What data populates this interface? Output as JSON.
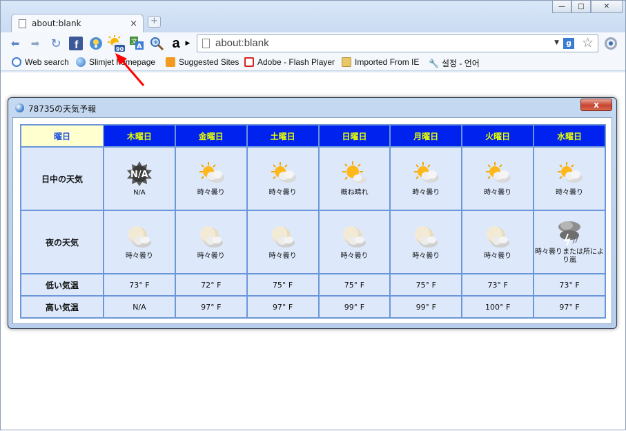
{
  "browser": {
    "tab_title": "about:blank",
    "tab_close": "×",
    "new_tab": "+",
    "url": "about:blank",
    "window_buttons": {
      "minimize": "—",
      "maximize": "□",
      "close": "✕"
    },
    "bookmarks": [
      {
        "label": "Web search",
        "icon": "search-icon",
        "color": "#3b7bd4"
      },
      {
        "label": "Slimjet homepage",
        "icon": "globe-icon",
        "color": "#2f74c8"
      },
      {
        "label": "Suggested Sites",
        "icon": "suggested-sites-icon",
        "color": "#f29b1f"
      },
      {
        "label": "Adobe - Flash Player",
        "icon": "adobe-icon",
        "color": "#d81f1f"
      },
      {
        "label": "Imported From IE",
        "icon": "folder-icon",
        "color": "#e8c769"
      },
      {
        "label": "설정 - 언어",
        "icon": "wrench-icon",
        "color": "#555555"
      }
    ],
    "weather_badge": "90"
  },
  "popup": {
    "title": "78735の天気予報",
    "close_label": "x",
    "corner_header": "曜日",
    "days": [
      "木曜日",
      "金曜日",
      "土曜日",
      "日曜日",
      "月曜日",
      "火曜日",
      "水曜日"
    ],
    "row_labels": {
      "day_weather": "日中の天気",
      "night_weather": "夜の天気",
      "low_temp": "低い気温",
      "high_temp": "高い気温"
    },
    "day_forecast": [
      {
        "icon": "na-icon",
        "text": "N/A"
      },
      {
        "icon": "partly-cloudy-day-icon",
        "text": "時々曇り"
      },
      {
        "icon": "partly-cloudy-day-icon",
        "text": "時々曇り"
      },
      {
        "icon": "mostly-sunny-icon",
        "text": "概ね晴れ"
      },
      {
        "icon": "partly-cloudy-day-icon",
        "text": "時々曇り"
      },
      {
        "icon": "partly-cloudy-day-icon",
        "text": "時々曇り"
      },
      {
        "icon": "partly-cloudy-day-icon",
        "text": "時々曇り"
      }
    ],
    "night_forecast": [
      {
        "icon": "partly-cloudy-night-icon",
        "text": "時々曇り"
      },
      {
        "icon": "partly-cloudy-night-icon",
        "text": "時々曇り"
      },
      {
        "icon": "partly-cloudy-night-icon",
        "text": "時々曇り"
      },
      {
        "icon": "partly-cloudy-night-icon",
        "text": "時々曇り"
      },
      {
        "icon": "partly-cloudy-night-icon",
        "text": "時々曇り"
      },
      {
        "icon": "partly-cloudy-night-icon",
        "text": "時々曇り"
      },
      {
        "icon": "storm-icon",
        "text": "時々曇りまたは所により嵐"
      }
    ],
    "low_temps": [
      "73° F",
      "72° F",
      "75° F",
      "75° F",
      "75° F",
      "73° F",
      "73° F"
    ],
    "high_temps": [
      "N/A",
      "97° F",
      "97° F",
      "99° F",
      "99° F",
      "100° F",
      "97° F"
    ]
  },
  "colors": {
    "header_bg": "#0022ee",
    "header_text": "#e6ff00",
    "corner_bg": "#ffffd0",
    "cell_bg": "#dde9fb",
    "annotation_arrow": "#ff0000"
  }
}
